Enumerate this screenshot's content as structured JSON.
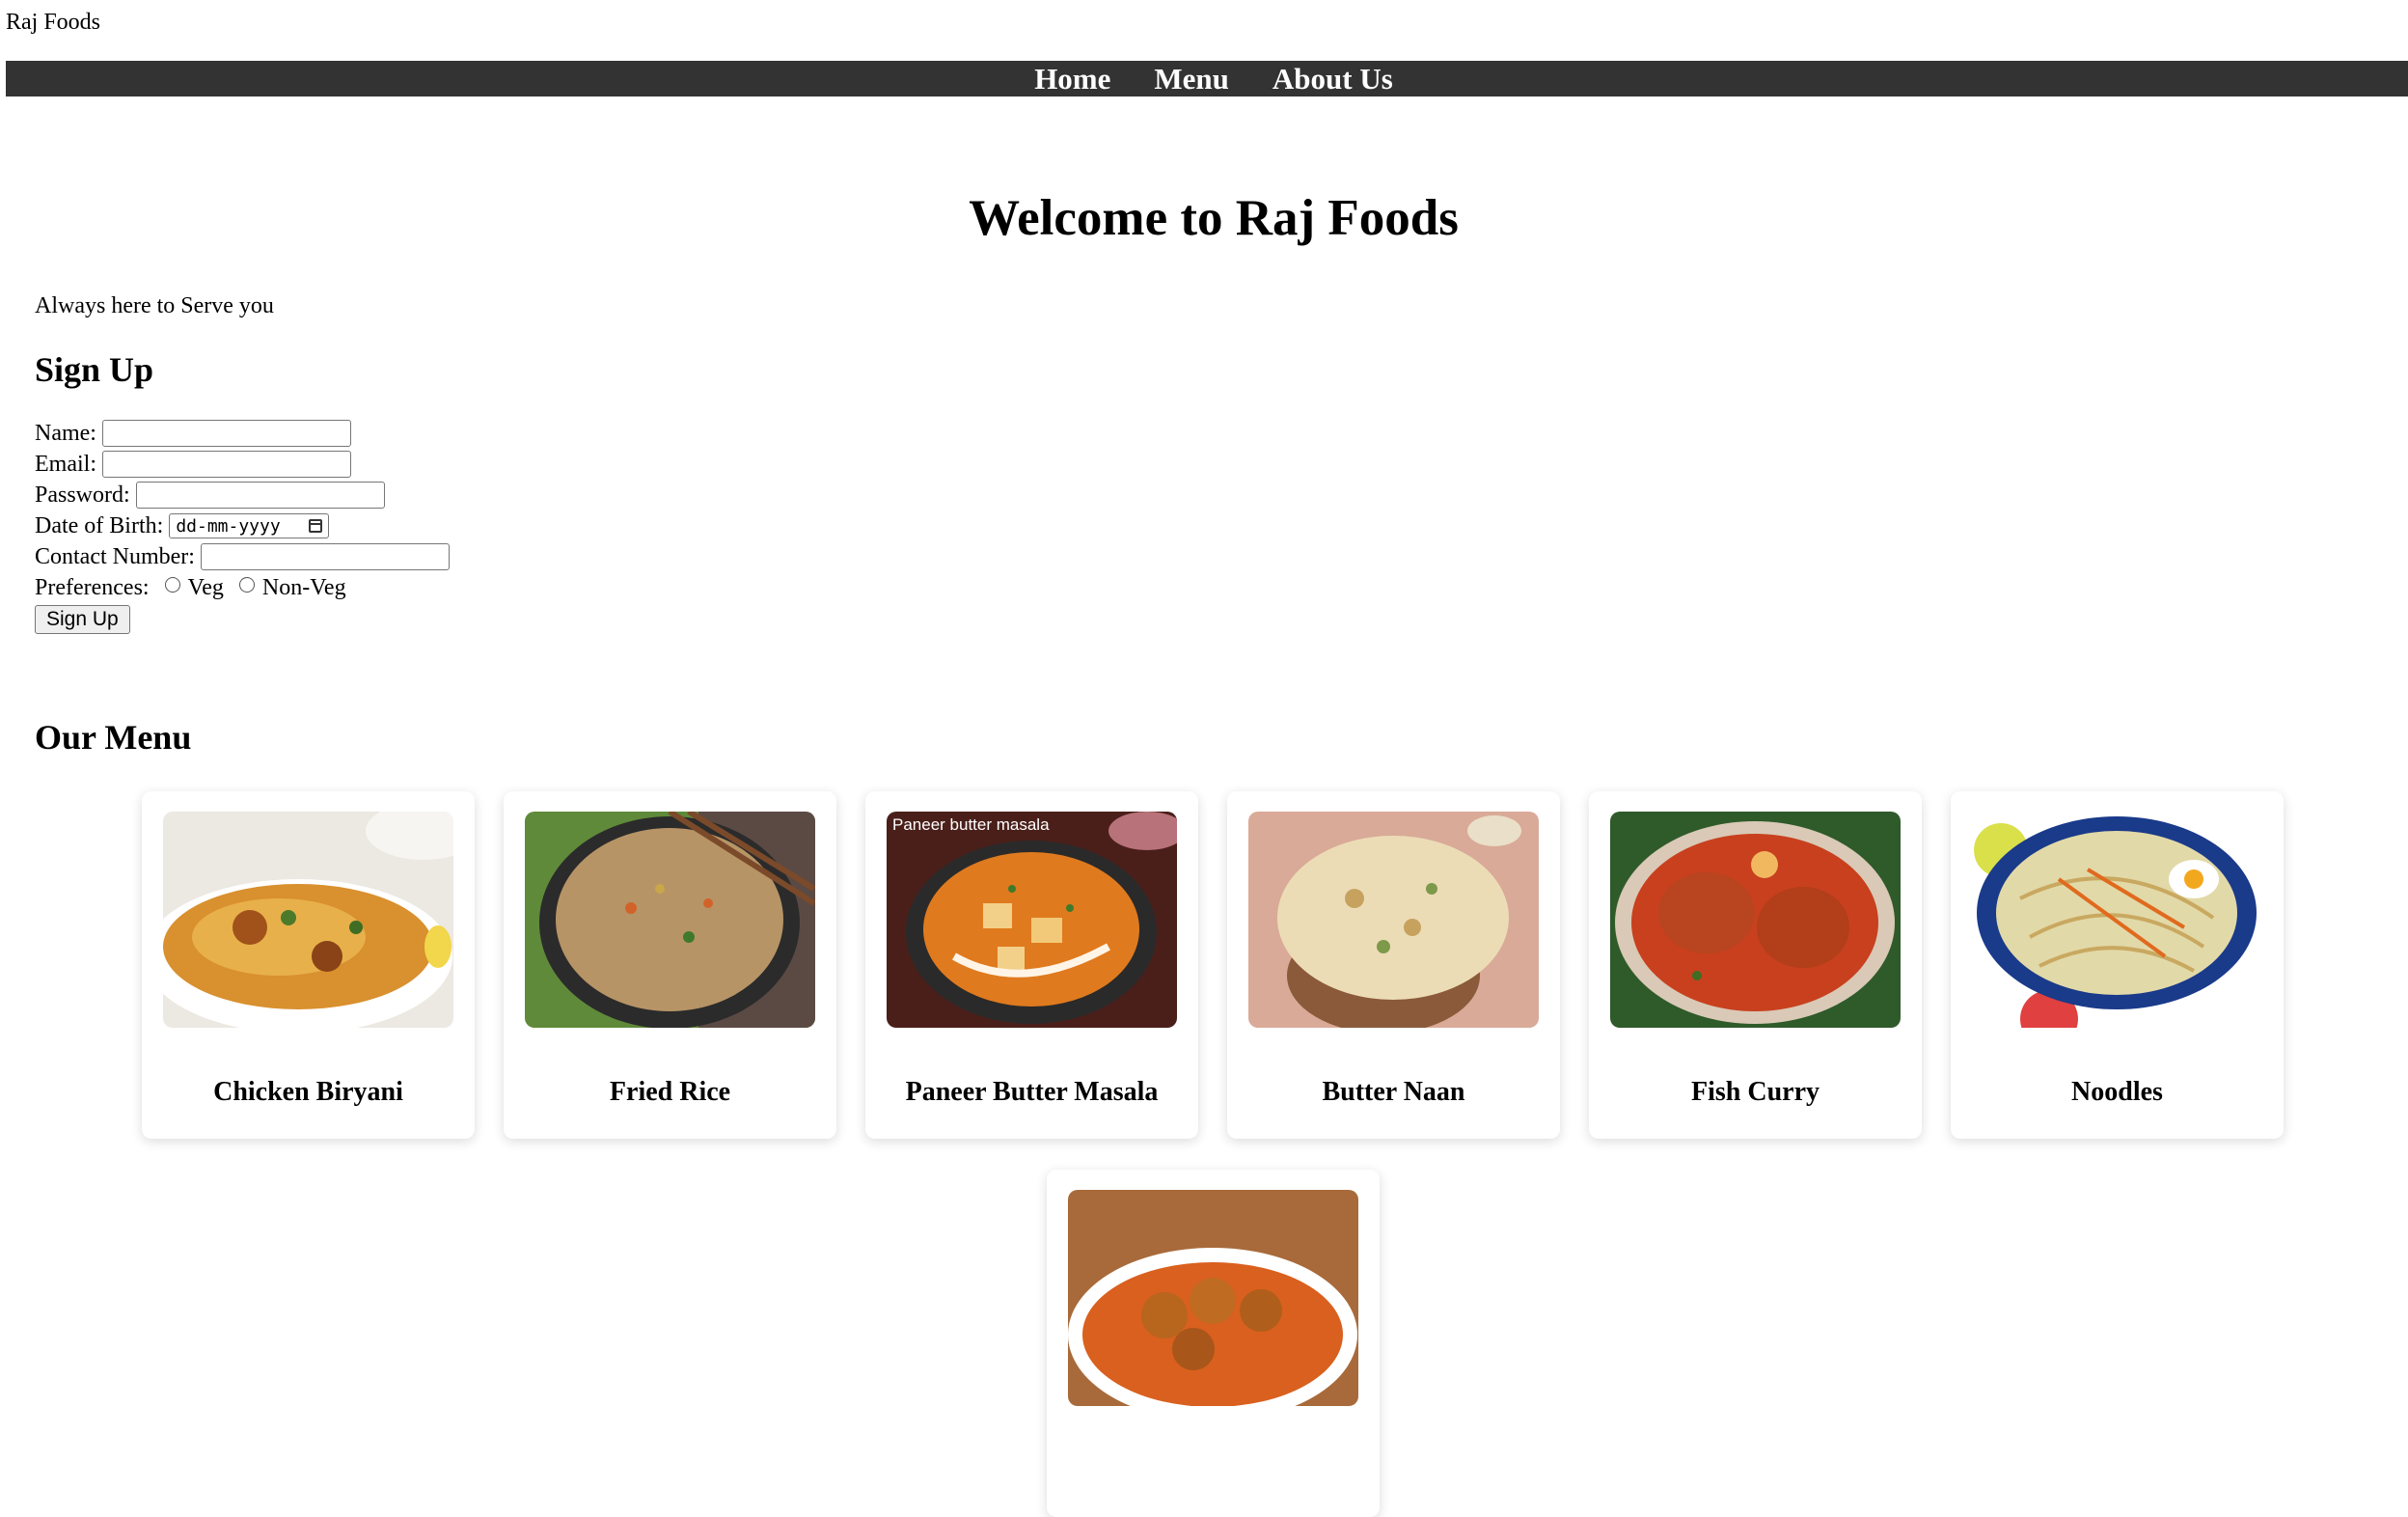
{
  "site": {
    "title": "Raj Foods"
  },
  "nav": {
    "items": [
      "Home",
      "Menu",
      "About Us"
    ]
  },
  "hero": {
    "heading": "Welcome to Raj Foods",
    "tagline": "Always here to Serve you"
  },
  "signup": {
    "heading": "Sign Up",
    "name_label": "Name:",
    "email_label": "Email:",
    "password_label": "Password:",
    "dob_label": "Date of Birth:",
    "dob_placeholder": "dd-mm-yyyy",
    "contact_label": "Contact Number:",
    "preferences_label": "Preferences:",
    "options": [
      "Veg",
      "Non-Veg"
    ],
    "submit_label": "Sign Up"
  },
  "menu": {
    "heading": "Our Menu",
    "items": [
      {
        "name": "Chicken Biryani"
      },
      {
        "name": "Fried Rice"
      },
      {
        "name": "Paneer Butter Masala",
        "image_caption": "Paneer butter masala"
      },
      {
        "name": "Butter Naan"
      },
      {
        "name": "Fish Curry"
      },
      {
        "name": "Noodles"
      },
      {
        "name": ""
      }
    ]
  },
  "colors": {
    "navbar_bg": "#333333",
    "nav_text": "#ffffff",
    "page_bg": "#ffffff"
  }
}
